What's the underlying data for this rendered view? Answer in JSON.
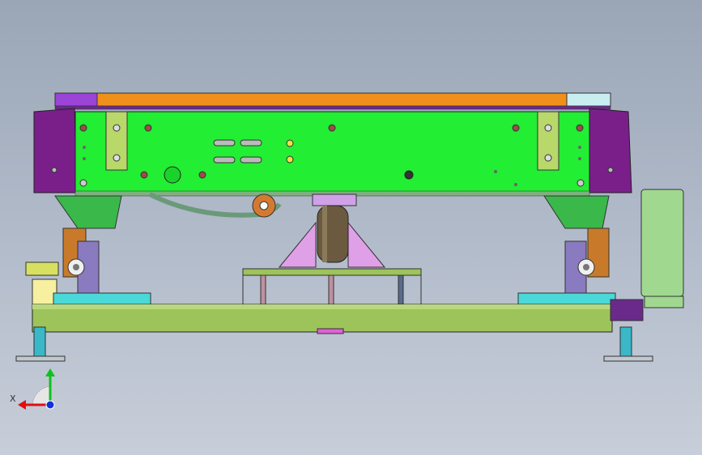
{
  "viewport": {
    "background_top": "#9aa6b6",
    "background_bottom": "#c7ced9",
    "model": {
      "description_colors": {
        "top_bar": "#f0901a",
        "top_bar_left": "#9a44d8",
        "top_bar_right": "#c8eef0",
        "main_plate": "#22ee33",
        "side_blocks": "#7a1f8a",
        "base_rail": "#9dc45a",
        "wheel": "#6b5a40"
      }
    }
  },
  "triad": {
    "x_label": "X",
    "x_color": "#e01010",
    "y_color": "#10c020",
    "z_color": "#1030e0"
  }
}
